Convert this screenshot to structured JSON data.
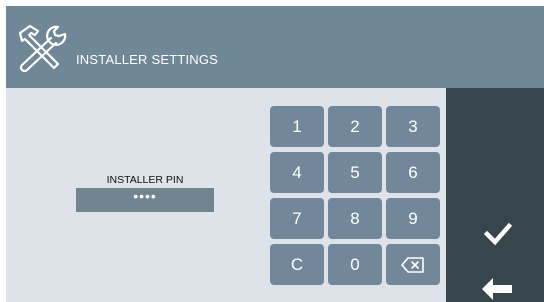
{
  "header": {
    "icon": "tools-icon",
    "title": "INSTALLER SETTINGS"
  },
  "pin": {
    "label": "INSTALLER PIN",
    "value": "••••"
  },
  "keypad": {
    "keys": [
      "1",
      "2",
      "3",
      "4",
      "5",
      "6",
      "7",
      "8",
      "9",
      "C",
      "0"
    ],
    "backspace_icon": "backspace-icon"
  },
  "sidebar": {
    "confirm_icon": "checkmark-icon",
    "back_icon": "arrow-left-icon"
  },
  "colors": {
    "header": "#6f8796",
    "content": "#dde3e8",
    "key": "#72889a",
    "pin_field": "#71848f",
    "sidebar": "#37464d"
  }
}
